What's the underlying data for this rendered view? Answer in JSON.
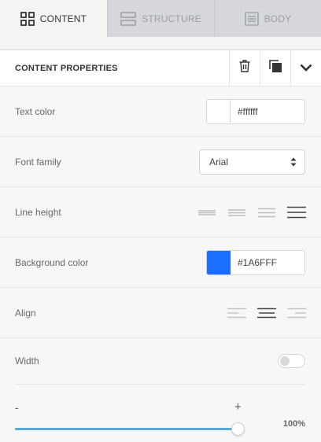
{
  "tabs": [
    {
      "label": "CONTENT",
      "icon": "grid-icon",
      "active": true
    },
    {
      "label": "STRUCTURE",
      "icon": "rows-icon",
      "active": false
    },
    {
      "label": "BODY",
      "icon": "document-icon",
      "active": false
    }
  ],
  "panel": {
    "title": "CONTENT PROPERTIES",
    "actions": [
      "trash-icon",
      "duplicate-icon",
      "chevron-down-icon"
    ]
  },
  "properties": {
    "text_color": {
      "label": "Text color",
      "value": "#ffffff",
      "swatch": "#ffffff"
    },
    "font_family": {
      "label": "Font family",
      "value": "Arial"
    },
    "line_height": {
      "label": "Line height",
      "options": [
        "line-height-1-icon",
        "line-height-2-icon",
        "line-height-3-icon",
        "line-height-4-icon"
      ],
      "selected": 3
    },
    "background_color": {
      "label": "Background color",
      "value": "#1A6FFF",
      "swatch": "#1A6FFF"
    },
    "align": {
      "label": "Align",
      "options": [
        "align-left-icon",
        "align-center-icon",
        "align-right-icon"
      ],
      "selected": 1
    },
    "width": {
      "label": "Width",
      "auto_toggle": false,
      "minus": "-",
      "plus": "+",
      "value_percent": 100,
      "value_text": "100%"
    }
  },
  "colors": {
    "accent": "#5ba8d4",
    "tab_inactive": "#d5d7da"
  }
}
